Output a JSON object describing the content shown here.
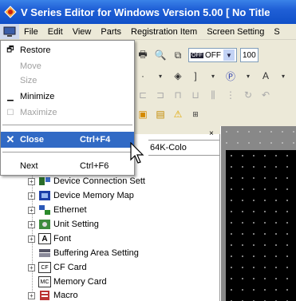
{
  "window": {
    "title": "V Series Editor for Windows Version 5.00 [ No Title"
  },
  "menubar": {
    "items": [
      "File",
      "Edit",
      "View",
      "Parts",
      "Registration Item",
      "Screen Setting",
      "S"
    ]
  },
  "toolbar": {
    "combo1_value": "OFF",
    "combo2_value": "100"
  },
  "system_menu": {
    "items": [
      {
        "label": "Restore",
        "accel": "",
        "enabled": true
      },
      {
        "label": "Move",
        "accel": "",
        "enabled": false
      },
      {
        "label": "Size",
        "accel": "",
        "enabled": false
      },
      {
        "label": "Minimize",
        "accel": "",
        "enabled": true
      },
      {
        "label": "Maximize",
        "accel": "",
        "enabled": false
      },
      {
        "label": "Close",
        "accel": "Ctrl+F4",
        "enabled": true,
        "selected": true
      },
      {
        "label": "Next",
        "accel": "Ctrl+F6",
        "enabled": true
      }
    ]
  },
  "panel": {
    "partial_tab": "64K-Colo",
    "close_glyph": "×"
  },
  "tree": {
    "items": [
      {
        "label": "Device Connection Sett",
        "icon": "device-connection-icon"
      },
      {
        "label": "Device Memory Map",
        "icon": "memory-map-icon"
      },
      {
        "label": "Ethernet",
        "icon": "ethernet-icon"
      },
      {
        "label": "Unit Setting",
        "icon": "unit-setting-icon"
      },
      {
        "label": "Font",
        "icon": "font-icon"
      },
      {
        "label": "Buffering Area Setting",
        "icon": "buffering-icon"
      },
      {
        "label": "CF Card",
        "icon": "cf-card-icon"
      },
      {
        "label": "Memory Card",
        "icon": "memory-card-icon"
      },
      {
        "label": "Macro",
        "icon": "macro-icon"
      }
    ]
  },
  "colors": {
    "title_bar": "#1f5fd6",
    "menu_highlight": "#316ac5",
    "chrome": "#ece9d8"
  }
}
